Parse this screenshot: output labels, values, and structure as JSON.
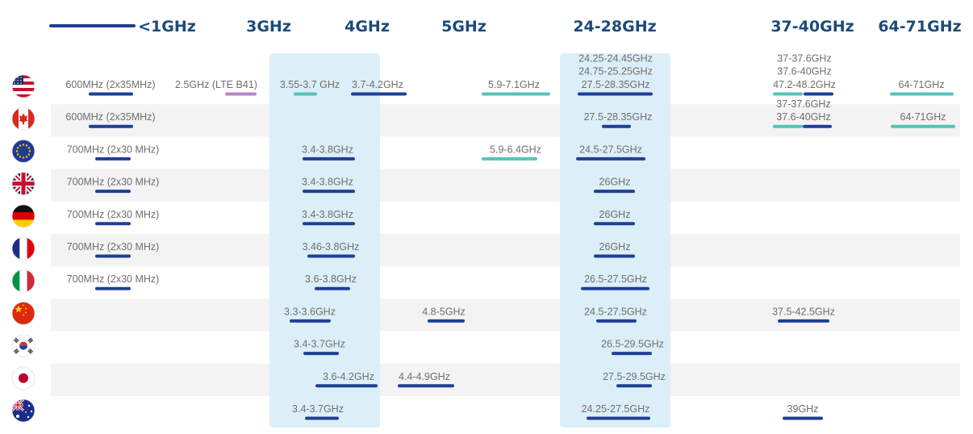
{
  "chart_data": {
    "type": "table",
    "bands": [
      "<1GHz",
      "3GHz",
      "4GHz",
      "5GHz",
      "24-28GHz",
      "37-40GHz",
      "64-71GHz"
    ],
    "highlighted_bands": [
      "3-4GHz",
      "24-28GHz"
    ],
    "colors": {
      "band_header": "#1c4b7a",
      "highlight_column": "#dceff8",
      "row_stripe": "#f3f3f4",
      "licensed_bar": "#1f3f96",
      "unlicensed_bar": "#55c2b9",
      "lte_bar": "#b884c8",
      "label_text": "#6e6e6e"
    },
    "bar_legend": {
      "licensed_bar": "dark blue",
      "unlicensed_bar": "teal",
      "lte_bar": "purple"
    },
    "countries": [
      {
        "flag": "united-states-flag-icon",
        "allocations": [
          {
            "band": "<1GHz",
            "labels": [
              "600MHz (2x35MHz)"
            ],
            "bar_types": [
              "licensed"
            ]
          },
          {
            "band": "<1GHz",
            "labels": [
              "2.5GHz (LTE B41)"
            ],
            "bar_types": [
              "lte"
            ]
          },
          {
            "band": "3-4GHz",
            "labels": [
              "3.55-3.7 GHz"
            ],
            "bar_types": [
              "unlicensed"
            ]
          },
          {
            "band": "3-4GHz",
            "labels": [
              "3.7-4.2GHz"
            ],
            "bar_types": [
              "licensed"
            ]
          },
          {
            "band": "5GHz",
            "labels": [
              "5.9-7.1GHz"
            ],
            "bar_types": [
              "unlicensed"
            ]
          },
          {
            "band": "24-28GHz",
            "labels": [
              "24.25-24.45GHz",
              "24.75-25.25GHz",
              "27.5-28.35GHz"
            ],
            "bar_types": [
              "licensed"
            ]
          },
          {
            "band": "37-40GHz",
            "labels": [
              "37-37.6GHz",
              "37.6-40GHz",
              "47.2-48.2GHz"
            ],
            "bar_types": [
              "unlicensed",
              "licensed"
            ]
          },
          {
            "band": "64-71GHz",
            "labels": [
              "64-71GHz"
            ],
            "bar_types": [
              "unlicensed"
            ]
          }
        ]
      },
      {
        "flag": "canada-flag-icon",
        "allocations": [
          {
            "band": "<1GHz",
            "labels": [
              "600MHz (2x35MHz)"
            ],
            "bar_types": [
              "licensed"
            ]
          },
          {
            "band": "24-28GHz",
            "labels": [
              "27.5-28.35GHz"
            ],
            "bar_types": [
              "licensed"
            ]
          },
          {
            "band": "37-40GHz",
            "labels": [
              "37-37.6GHz",
              "37.6-40GHz"
            ],
            "bar_types": [
              "unlicensed",
              "licensed"
            ]
          },
          {
            "band": "64-71GHz",
            "labels": [
              "64-71GHz"
            ],
            "bar_types": [
              "unlicensed"
            ]
          }
        ]
      },
      {
        "flag": "european-union-flag-icon",
        "allocations": [
          {
            "band": "<1GHz",
            "labels": [
              "700MHz (2x30 MHz)"
            ],
            "bar_types": [
              "licensed"
            ]
          },
          {
            "band": "3-4GHz",
            "labels": [
              "3.4-3.8GHz"
            ],
            "bar_types": [
              "licensed"
            ]
          },
          {
            "band": "5GHz",
            "labels": [
              "5.9-6.4GHz"
            ],
            "bar_types": [
              "unlicensed"
            ]
          },
          {
            "band": "24-28GHz",
            "labels": [
              "24.5-27.5GHz"
            ],
            "bar_types": [
              "licensed"
            ]
          }
        ]
      },
      {
        "flag": "united-kingdom-flag-icon",
        "allocations": [
          {
            "band": "<1GHz",
            "labels": [
              "700MHz (2x30 MHz)"
            ],
            "bar_types": [
              "licensed"
            ]
          },
          {
            "band": "3-4GHz",
            "labels": [
              "3.4-3.8GHz"
            ],
            "bar_types": [
              "licensed"
            ]
          },
          {
            "band": "24-28GHz",
            "labels": [
              "26GHz"
            ],
            "bar_types": [
              "licensed"
            ]
          }
        ]
      },
      {
        "flag": "germany-flag-icon",
        "allocations": [
          {
            "band": "<1GHz",
            "labels": [
              "700MHz (2x30 MHz)"
            ],
            "bar_types": [
              "licensed"
            ]
          },
          {
            "band": "3-4GHz",
            "labels": [
              "3.4-3.8GHz"
            ],
            "bar_types": [
              "licensed"
            ]
          },
          {
            "band": "24-28GHz",
            "labels": [
              "26GHz"
            ],
            "bar_types": [
              "licensed"
            ]
          }
        ]
      },
      {
        "flag": "france-flag-icon",
        "allocations": [
          {
            "band": "<1GHz",
            "labels": [
              "700MHz (2x30 MHz)"
            ],
            "bar_types": [
              "licensed"
            ]
          },
          {
            "band": "3-4GHz",
            "labels": [
              "3.46-3.8GHz"
            ],
            "bar_types": [
              "licensed"
            ]
          },
          {
            "band": "24-28GHz",
            "labels": [
              "26GHz"
            ],
            "bar_types": [
              "licensed"
            ]
          }
        ]
      },
      {
        "flag": "italy-flag-icon",
        "allocations": [
          {
            "band": "<1GHz",
            "labels": [
              "700MHz (2x30 MHz)"
            ],
            "bar_types": [
              "licensed"
            ]
          },
          {
            "band": "3-4GHz",
            "labels": [
              "3.6-3.8GHz"
            ],
            "bar_types": [
              "licensed"
            ]
          },
          {
            "band": "24-28GHz",
            "labels": [
              "26.5-27.5GHz"
            ],
            "bar_types": [
              "licensed"
            ]
          }
        ]
      },
      {
        "flag": "china-flag-icon",
        "allocations": [
          {
            "band": "3-4GHz",
            "labels": [
              "3.3-3.6GHz"
            ],
            "bar_types": [
              "licensed"
            ]
          },
          {
            "band": "5GHz",
            "labels": [
              "4.8-5GHz"
            ],
            "bar_types": [
              "licensed"
            ]
          },
          {
            "band": "24-28GHz",
            "labels": [
              "24.5-27.5GHz"
            ],
            "bar_types": [
              "licensed"
            ]
          },
          {
            "band": "37-40GHz",
            "labels": [
              "37.5-42.5GHz"
            ],
            "bar_types": [
              "licensed"
            ]
          }
        ]
      },
      {
        "flag": "south-korea-flag-icon",
        "allocations": [
          {
            "band": "3-4GHz",
            "labels": [
              "3.4-3.7GHz"
            ],
            "bar_types": [
              "licensed"
            ]
          },
          {
            "band": "24-28GHz",
            "labels": [
              "26.5-29.5GHz"
            ],
            "bar_types": [
              "licensed"
            ]
          }
        ]
      },
      {
        "flag": "japan-flag-icon",
        "allocations": [
          {
            "band": "3-4GHz",
            "labels": [
              "3.6-4.2GHz"
            ],
            "bar_types": [
              "licensed"
            ]
          },
          {
            "band": "5GHz",
            "labels": [
              "4.4-4.9GHz"
            ],
            "bar_types": [
              "licensed"
            ]
          },
          {
            "band": "24-28GHz",
            "labels": [
              "27.5-29.5GHz"
            ],
            "bar_types": [
              "licensed"
            ]
          }
        ]
      },
      {
        "flag": "australia-flag-icon",
        "allocations": [
          {
            "band": "3-4GHz",
            "labels": [
              "3.4-3.7GHz"
            ],
            "bar_types": [
              "licensed"
            ]
          },
          {
            "band": "24-28GHz",
            "labels": [
              "24.25-27.5GHz"
            ],
            "bar_types": [
              "licensed"
            ]
          },
          {
            "band": "37-40GHz",
            "labels": [
              "39GHz"
            ],
            "bar_types": [
              "licensed"
            ]
          }
        ]
      }
    ]
  }
}
